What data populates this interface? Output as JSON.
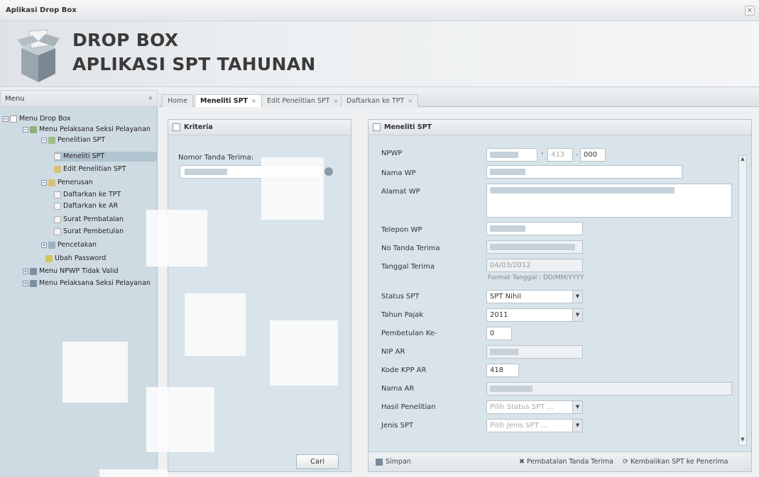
{
  "window": {
    "title": "Aplikasi Drop Box"
  },
  "banner": {
    "line1": "DROP BOX",
    "line2": "APLIKASI SPT TAHUNAN"
  },
  "menu": {
    "title": "Menu",
    "tree": [
      {
        "label": "Menu Drop Box",
        "icon": "folder-icon"
      },
      {
        "label": "Menu Pelaksana Seksi Pelayanan",
        "icon": "user-icon"
      },
      {
        "label": "Penelitian SPT",
        "icon": "check-icon"
      },
      {
        "label": "Meneliti SPT",
        "icon": "doc-icon"
      },
      {
        "label": "Edit Penelitian SPT",
        "icon": "pencil-icon"
      },
      {
        "label": "Penerusan",
        "icon": "pencil-icon"
      },
      {
        "label": "Daftarkan ke TPT",
        "icon": "doc-icon"
      },
      {
        "label": "Daftarkan ke AR",
        "icon": "doc-icon"
      },
      {
        "label": "Surat Pembatalan",
        "icon": "doc-icon"
      },
      {
        "label": "Surat Pembetulan",
        "icon": "doc-icon"
      },
      {
        "label": "Pencetakan",
        "icon": "printer-icon"
      },
      {
        "label": "Ubah Password",
        "icon": "key-icon"
      },
      {
        "label": "Menu NPWP Tidak Valid",
        "icon": "users-icon"
      },
      {
        "label": "Menu Pelaksana Seksi Pelayanan",
        "icon": "users-icon"
      }
    ]
  },
  "tabs": [
    "Home",
    "Meneliti SPT",
    "Edit Penelitian SPT",
    "Daftarkan ke TPT"
  ],
  "kriteria": {
    "title": "Kriteria",
    "nomor_label": "Nomor Tanda Terima:",
    "cari": "Cari"
  },
  "form": {
    "title": "Meneliti SPT",
    "npwp_label": "NPWP",
    "npwp_mid": "413",
    "npwp_last": "000",
    "nama_label": "Nama WP",
    "alamat_label": "Alamat WP",
    "telepon_label": "Telepon WP",
    "notanda_label": "No Tanda Terima",
    "tanggal_label": "Tanggal Terima",
    "tanggal_value": "04/03/2012",
    "tanggal_hint": "Format Tanggal : DD/MM/YYYY",
    "status_label": "Status SPT",
    "status_value": "SPT Nihil",
    "tahun_label": "Tahun Pajak",
    "tahun_value": "2011",
    "pembetulan_label": "Pembetulan Ke-",
    "pembetulan_value": "0",
    "nipar_label": "NIP AR",
    "kodekpp_label": "Kode KPP AR",
    "kodekpp_value": "418",
    "namaar_label": "Nama AR",
    "hasil_label": "Hasil Penelitian",
    "hasil_placeholder": "Pilih Status SPT ...",
    "jenis_label": "Jenis SPT",
    "jenis_placeholder": "Pilih Jenis SPT ..."
  },
  "footer": {
    "simpan": "Simpan",
    "pembatalan": "Pembatalan Tanda Terima",
    "kembalikan": "Kembalikan SPT ke Penerima"
  }
}
